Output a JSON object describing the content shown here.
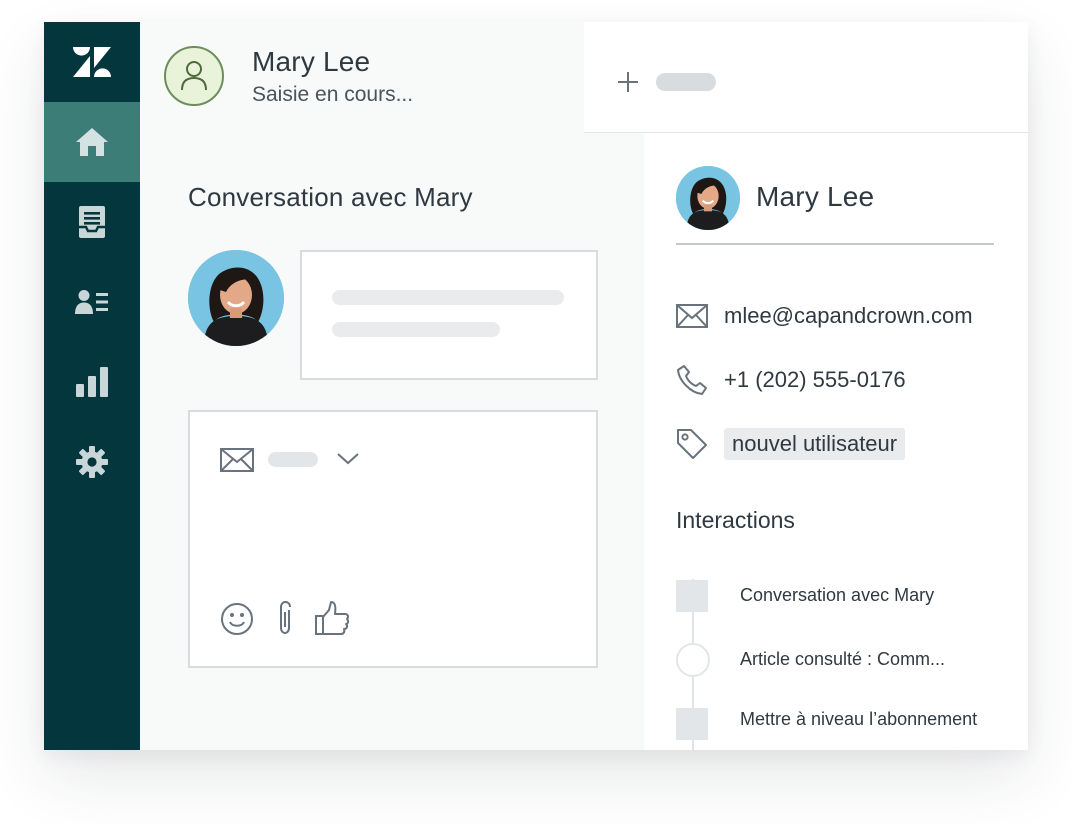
{
  "header": {
    "name": "Mary Lee",
    "status": "Saisie en cours..."
  },
  "conversation": {
    "title": "Conversation avec Mary"
  },
  "nav": {
    "items": [
      {
        "icon": "home-icon",
        "active": true
      },
      {
        "icon": "inbox-icon",
        "active": false
      },
      {
        "icon": "contacts-icon",
        "active": false
      },
      {
        "icon": "reports-icon",
        "active": false
      },
      {
        "icon": "settings-icon",
        "active": false
      }
    ]
  },
  "profile": {
    "name": "Mary Lee",
    "email": "mlee@capandcrown.com",
    "phone": "+1 (202) 555-0176",
    "tag": "nouvel utilisateur"
  },
  "interactions": {
    "title": "Interactions",
    "items": [
      {
        "label": "Conversation avec Mary",
        "marker": "square"
      },
      {
        "label": "Article consulté : Comm...",
        "marker": "circle"
      },
      {
        "label": "Mettre à niveau l’abonnement",
        "marker": "square"
      }
    ]
  },
  "colors": {
    "nav_bg": "#03363d",
    "nav_active": "#3c7d78",
    "nav_icon": "#c8d6d7",
    "avatar_bg": "#e9f3d9",
    "avatar_border": "#6d8d5a"
  }
}
